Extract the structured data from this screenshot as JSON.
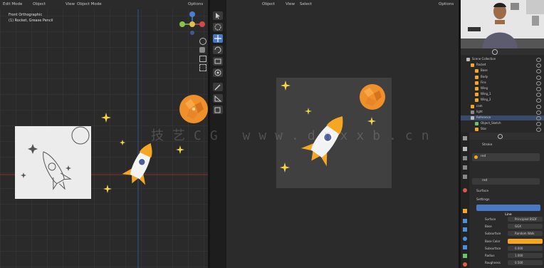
{
  "left_viewport": {
    "header": {
      "mode": "Edit Mode",
      "shading": "Object",
      "view": "View",
      "object": "Object Mode",
      "overlay": "Options"
    },
    "info_line1": "Front Orthographic",
    "info_line2": "(1) Rocket, Grease Pencil"
  },
  "middle_viewport": {
    "header": {
      "mode": "Object",
      "view": "View",
      "select": "Select",
      "options": "Options"
    }
  },
  "watermark": "技艺CG www.dnxxb.cn",
  "outliner": {
    "rows": [
      {
        "label": "Scene Collection"
      },
      {
        "label": "Rocket"
      },
      {
        "label": "Base"
      },
      {
        "label": "Body"
      },
      {
        "label": "Fins"
      },
      {
        "label": "Wing"
      },
      {
        "label": "Wing_1"
      },
      {
        "label": "Wing_2"
      },
      {
        "label": "cam"
      },
      {
        "label": "light"
      },
      {
        "label": "Reference"
      },
      {
        "label": "Object_Sketch"
      },
      {
        "label": "Star"
      }
    ]
  },
  "properties": {
    "object_name": "Stroke",
    "material_name": "red",
    "section1": "Surface",
    "section2": "Settings",
    "mode_button": "Line",
    "rows": [
      {
        "label": "Surface",
        "value": "Principled BSDF"
      },
      {
        "label": "Base",
        "value": "GGX"
      },
      {
        "label": "Subsurface",
        "value": "Random Walk"
      },
      {
        "label": "Base Color",
        "value": ""
      },
      {
        "label": "Subsurface",
        "value": "0.000"
      },
      {
        "label": "Radius",
        "value": "1.000"
      },
      {
        "label": "Roughness",
        "value": "0.500"
      }
    ]
  },
  "colors": {
    "accent": "#f5a623",
    "select_blue": "#4a90e2",
    "bg": "#1d1d1d"
  }
}
